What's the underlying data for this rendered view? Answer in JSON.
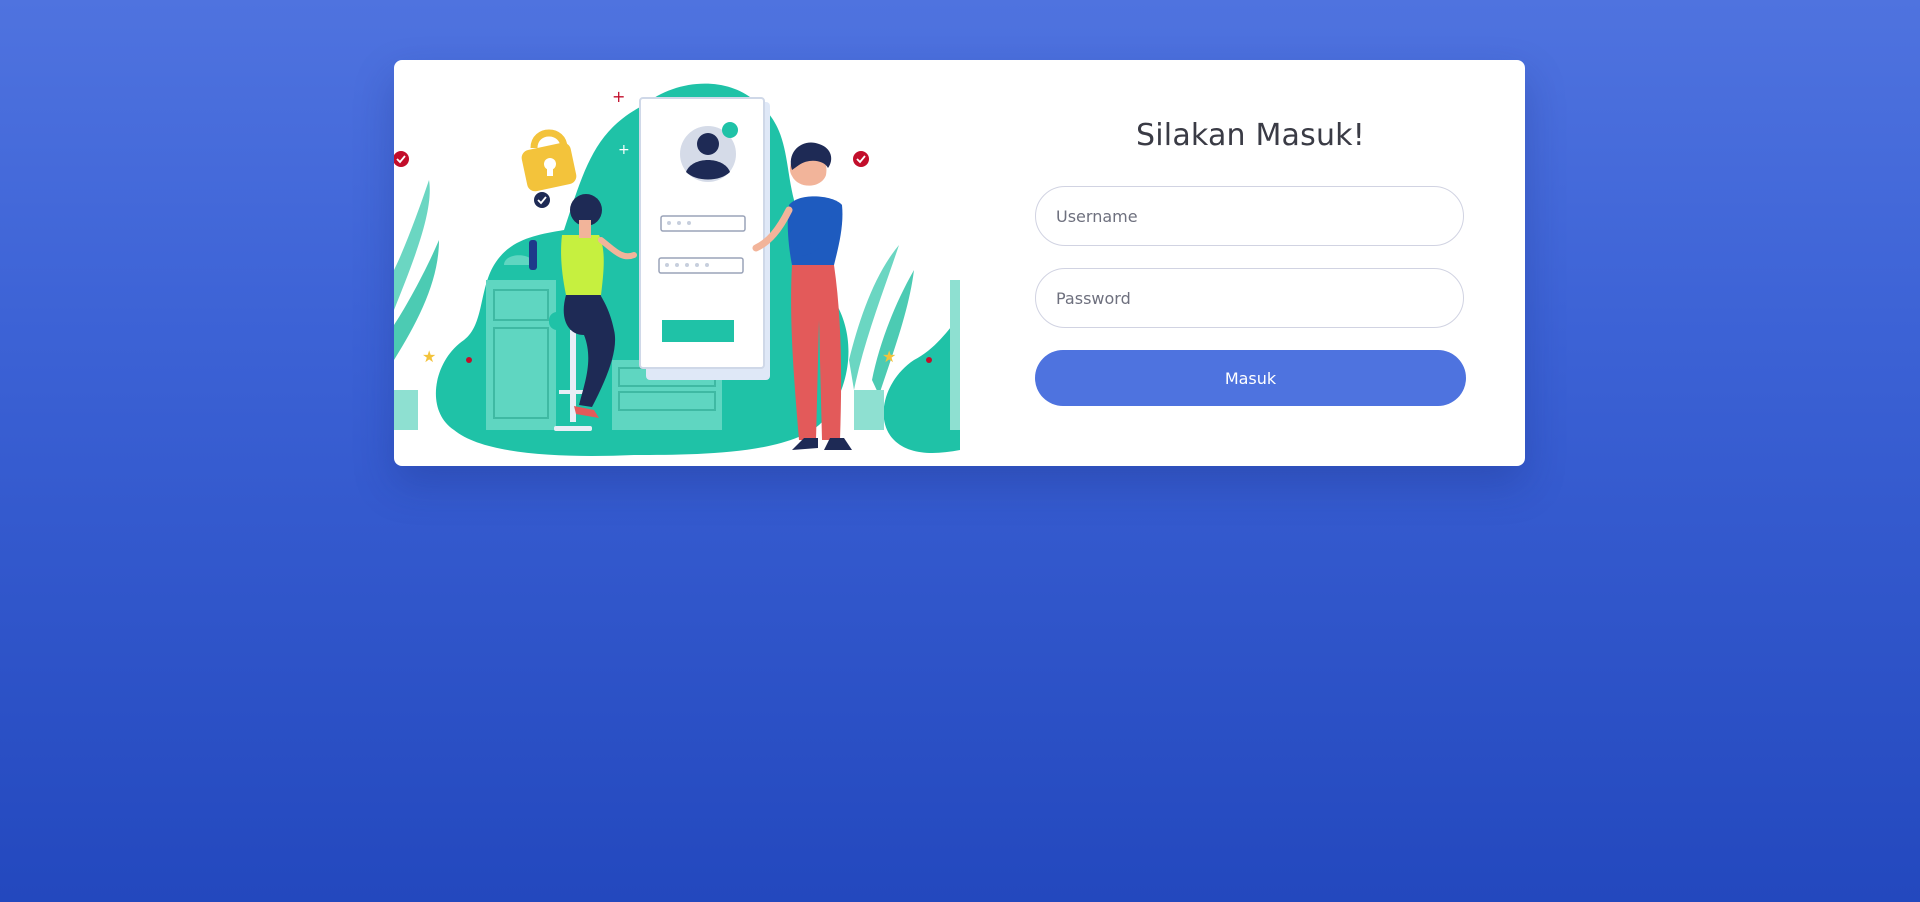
{
  "login": {
    "title": "Silakan Masuk!",
    "username_placeholder": "Username",
    "username_value": "",
    "password_placeholder": "Password",
    "password_value": "",
    "submit_label": "Masuk"
  },
  "colors": {
    "page_gradient_top": "#4f73df",
    "page_gradient_bottom": "#2348be",
    "card_background": "#ffffff",
    "button_primary": "#4e73df",
    "illustration_teal": "#1fc2a7"
  },
  "illustration": {
    "icons": [
      "padlock-icon",
      "user-avatar-icon",
      "check-badge-icon",
      "star-icon",
      "plant-icon"
    ]
  }
}
